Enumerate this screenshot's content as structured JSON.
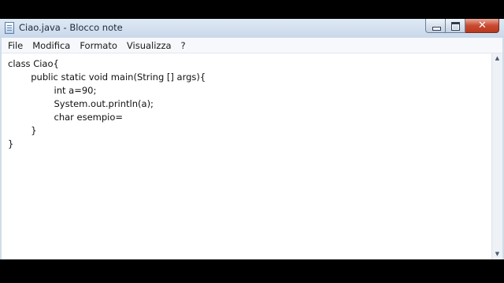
{
  "window": {
    "title": "Ciao.java - Blocco note",
    "controls": {
      "minimize": "minimize",
      "maximize": "maximize",
      "close": "✕"
    }
  },
  "menu": [
    "File",
    "Modifica",
    "Formato",
    "Visualizza",
    "?"
  ],
  "editor": {
    "lines": [
      "class Ciao{",
      "\t\tpublic static void main(String [] args){",
      "\t\t\t\tint a=90;",
      "\t\t\t\tSystem.out.println(a);",
      "\t\t\t\tchar esempio=",
      "\t\t}",
      "}"
    ]
  },
  "scrollbar": {
    "up": "▲",
    "down": "▼"
  },
  "icons": {
    "app": "notepad-icon",
    "minimize": "minimize-icon",
    "maximize": "maximize-icon",
    "close": "close-icon"
  },
  "colors": {
    "frame": "#cfdcea",
    "close_button": "#c94a31",
    "editor_background": "#ffffff",
    "outer_background": "#000000"
  }
}
